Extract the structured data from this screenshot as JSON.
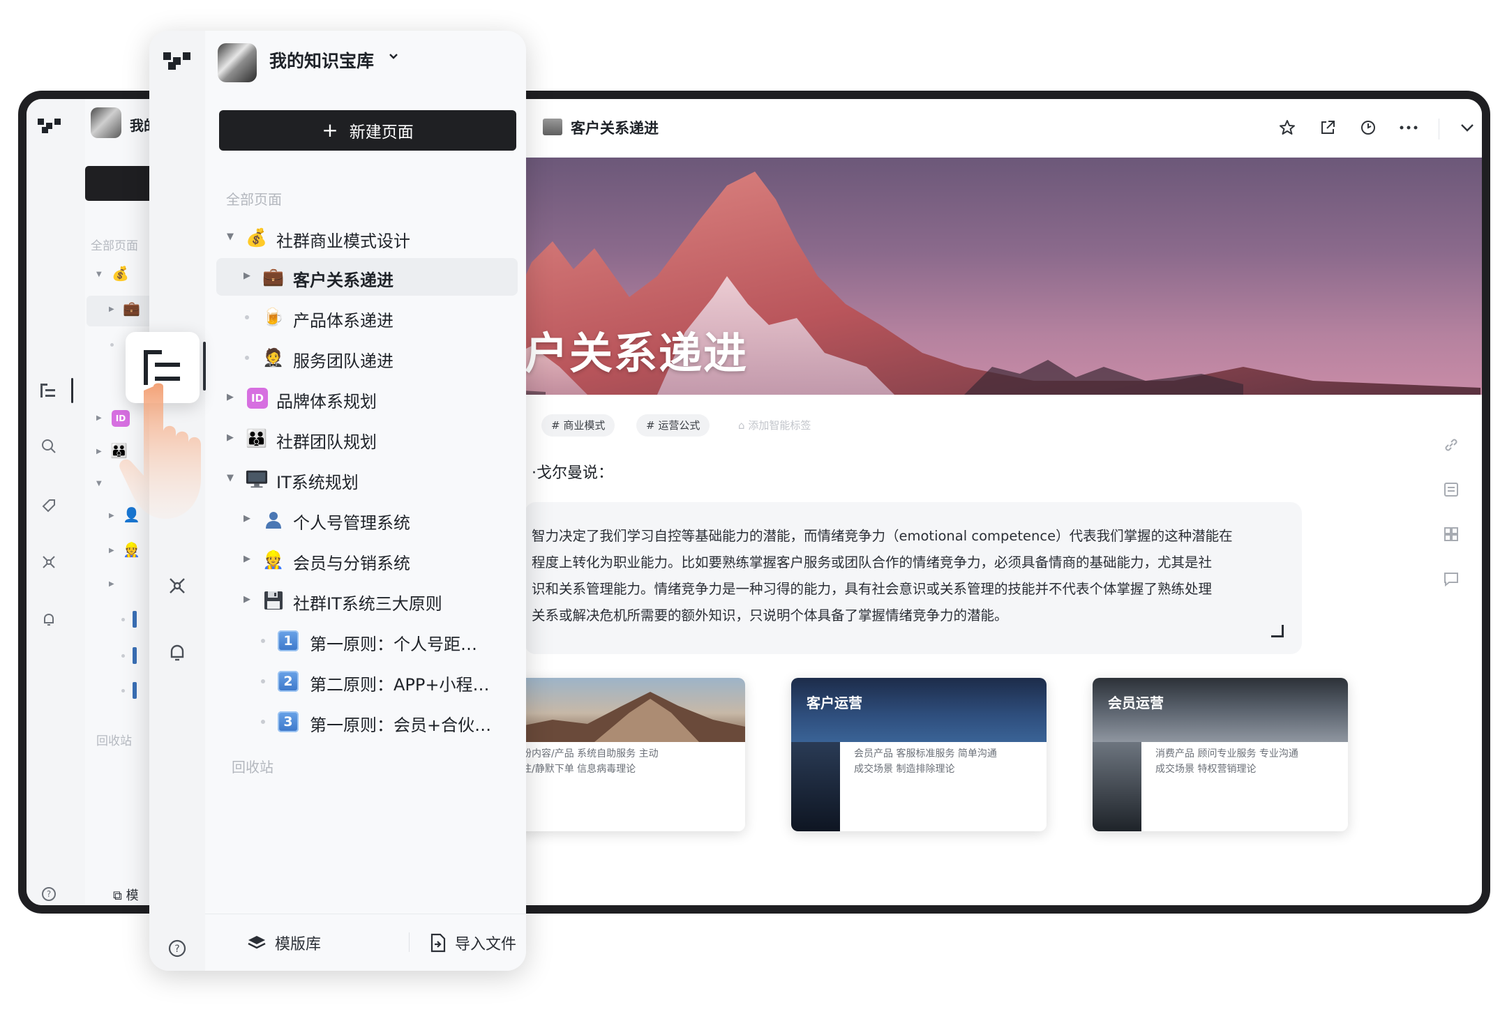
{
  "workspace": {
    "name": "我的知识宝库",
    "name_truncated": "我的",
    "new_page_label": "新建页面",
    "all_pages_label": "全部页面",
    "recycle_label": "回收站"
  },
  "tree": [
    {
      "label": "社群商业模式设计",
      "icon": "money-bag-icon",
      "glyph": "💰",
      "expanded": true,
      "level": 0
    },
    {
      "label": "客户关系递进",
      "icon": "briefcase-icon",
      "glyph": "💼",
      "level": 1,
      "selected": true
    },
    {
      "label": "产品体系递进",
      "icon": "beer-icon",
      "glyph": "🍺",
      "level": 1
    },
    {
      "label": "服务团队递进",
      "icon": "waiter-icon",
      "glyph": "🤵",
      "level": 1
    },
    {
      "label": "品牌体系规划",
      "icon": "id-icon",
      "glyph": "ID",
      "level": 0
    },
    {
      "label": "社群团队规划",
      "icon": "family-icon",
      "glyph": "👪",
      "level": 0
    },
    {
      "label": "IT系统规划",
      "icon": "computer-icon",
      "glyph": "",
      "expanded": true,
      "level": 0
    },
    {
      "label": "个人号管理系统",
      "icon": "person-icon",
      "glyph": "👤",
      "level": 1
    },
    {
      "label": "会员与分销系统",
      "icon": "worker-icon",
      "glyph": "👷",
      "level": 1
    },
    {
      "label": "社群IT系统三大原则",
      "icon": "floppy-icon",
      "glyph": "",
      "level": 1
    },
    {
      "label": "第一原则：个人号距…",
      "icon": "keycap-1-icon",
      "glyph": "1",
      "level": 2
    },
    {
      "label": "第二原则：APP+小程…",
      "icon": "keycap-2-icon",
      "glyph": "2",
      "level": 2
    },
    {
      "label": "第一原则：会员+合伙…",
      "icon": "keycap-3-icon",
      "glyph": "3",
      "level": 2
    }
  ],
  "footer": {
    "templates_label": "模版库",
    "templates_truncated": "模",
    "import_label": "导入文件"
  },
  "document": {
    "title": "客户关系递进",
    "banner_title": "户关系递进",
    "tags": [
      "# 商业模式",
      "# 运营公式"
    ],
    "add_tag_label": "添加智能标签",
    "quote_intro": "·戈尔曼说：",
    "quote_lines": [
      "智力决定了我们学习自控等基础能力的潜能，而情绪竞争力（emotional  competence）代表我们掌握的这种潜能在",
      "程度上转化为职业能力。比如要熟练掌握客户服务或团队合作的情绪竞争力，必须具备情商的基础能力，尤其是社",
      "识和关系管理能力。情绪竞争力是一种习得的能力，具有社会意识或关系管理的技能并不代表个体掌握了熟练处理",
      "关系或解决危机所需要的额外知识，只说明个体具备了掌握情绪竞争力的潜能。"
    ],
    "cards": [
      {
        "title": "",
        "body_line1": "吸粉内容/产品   系统自助服务   主动",
        "body_line2": "关注/静默下单   信息病毒理论"
      },
      {
        "title": "客户运营",
        "body_line1": "会员产品   客服标准服务   简单沟通",
        "body_line2": "成交场景   制造排除理论"
      },
      {
        "title": "会员运营",
        "body_line1": "消费产品   顾问专业服务   专业沟通",
        "body_line2": "成交场景   特权营销理论"
      }
    ]
  },
  "colors": {
    "accent_dark": "#1f2023",
    "banner_sky": "#8b6a8c",
    "id_badge": "#d66fe0",
    "keycap_blue": "#3c77c9"
  }
}
